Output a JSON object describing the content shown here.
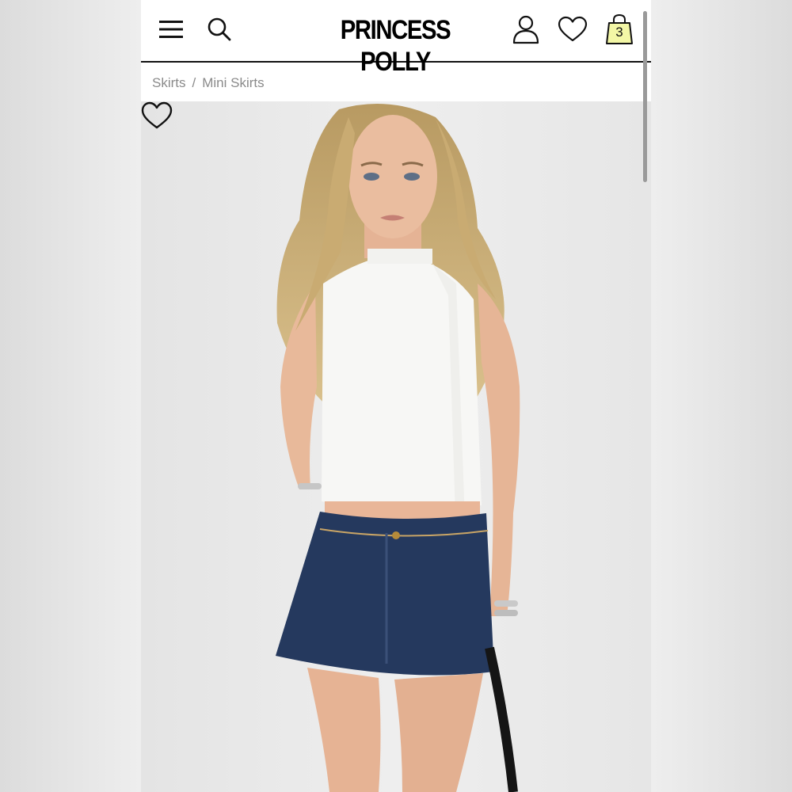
{
  "header": {
    "brand": "PRINCESS POLLY",
    "bag_count": "3",
    "icons": [
      "menu-icon",
      "search-icon",
      "account-icon",
      "heart-icon",
      "shopping-bag-icon"
    ]
  },
  "breadcrumb": {
    "items": [
      "Skirts",
      "Mini Skirts"
    ],
    "separator": "/"
  },
  "product_image": {
    "wishlist_icon": "heart-icon"
  },
  "colors": {
    "background": "#ffffff",
    "bag_badge": "#f3f7a6",
    "text_muted": "#8a8a8a",
    "denim": "#25395e"
  }
}
